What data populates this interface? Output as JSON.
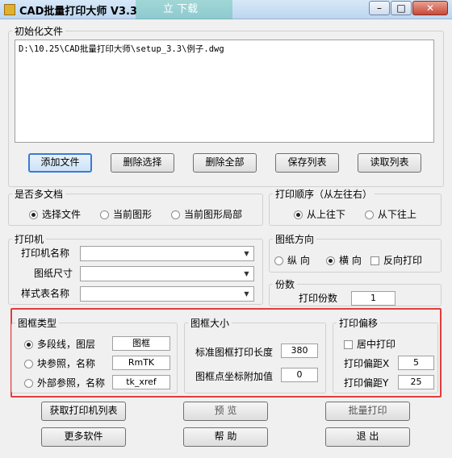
{
  "window": {
    "title": "CAD批量打印大师 V3.3",
    "ghost_text": "立 下载",
    "min": "–",
    "max": "□",
    "close": "✕"
  },
  "init_file": {
    "legend": "初始化文件",
    "path": "D:\\10.25\\CAD批量打印大师\\setup_3.3\\例子.dwg"
  },
  "file_buttons": {
    "add": "添加文件",
    "remove_sel": "删除选择",
    "remove_all": "删除全部",
    "save_list": "保存列表",
    "load_list": "读取列表"
  },
  "multi_doc": {
    "legend": "是否多文档",
    "opt1": "选择文件",
    "opt2": "当前图形",
    "opt3": "当前图形局部"
  },
  "print_order": {
    "legend": "打印顺序（从左往右）",
    "opt1": "从上往下",
    "opt2": "从下往上"
  },
  "printer": {
    "legend": "打印机",
    "name_label": "打印机名称",
    "paper_label": "图纸尺寸",
    "style_label": "样式表名称"
  },
  "orientation": {
    "legend": "图纸方向",
    "portrait": "纵 向",
    "landscape": "横 向",
    "reverse": "反向打印"
  },
  "copies": {
    "legend": "份数",
    "label": "打印份数",
    "value": "1"
  },
  "frame_type": {
    "legend": "图框类型",
    "opt1": "多段线，图层",
    "opt1_value": "图框",
    "opt2": "块参照，名称",
    "opt2_value": "RmTK",
    "opt3": "外部参照，名称",
    "opt3_value": "tk_xref"
  },
  "frame_size": {
    "legend": "图框大小",
    "std_label": "标准图框打印长度",
    "std_value": "380",
    "add_label": "图框点坐标附加值",
    "add_value": "0"
  },
  "offset": {
    "legend": "打印偏移",
    "center": "居中打印",
    "x_label": "打印偏距X",
    "x_value": "5",
    "y_label": "打印偏距Y",
    "y_value": "25"
  },
  "bottom_buttons": {
    "get_printers": "获取打印机列表",
    "preview": "预 览",
    "batch_print": "批量打印",
    "more": "更多软件",
    "help": "帮 助",
    "exit": "退 出"
  },
  "colors": {
    "highlight": "#e23c3c",
    "accent": "#3a7bd5"
  }
}
